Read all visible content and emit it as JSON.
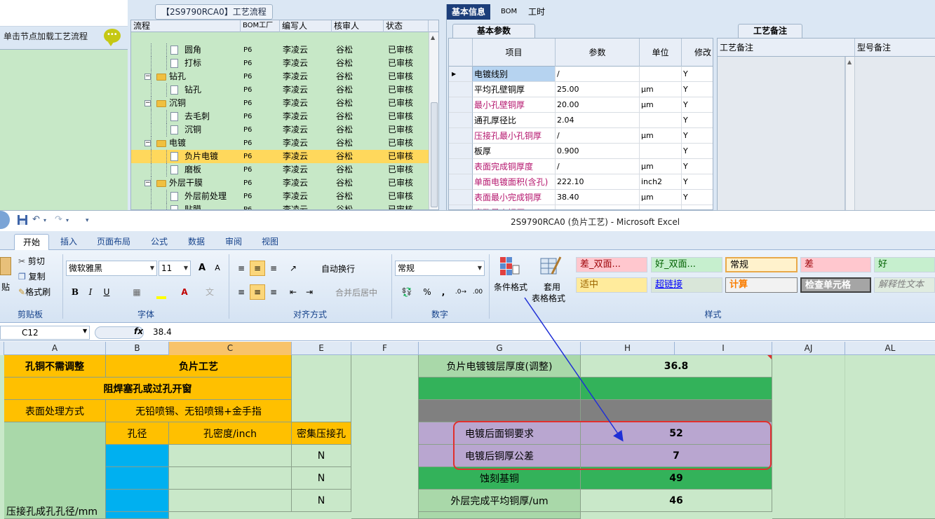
{
  "top_app": {
    "left_panel": {
      "hint": "单击节点加载工艺流程"
    },
    "flow_title": "【2S9790RCA0】工艺流程",
    "tree": {
      "columns": [
        "流程",
        "BOM工厂",
        "编写人",
        "核审人",
        "状态"
      ],
      "rows": [
        {
          "name": "圆角",
          "level": 2,
          "type": "doc",
          "factory": "P6",
          "writer": "李凌云",
          "reviewer": "谷松",
          "status": "已审核"
        },
        {
          "name": "打标",
          "level": 2,
          "type": "doc",
          "factory": "P6",
          "writer": "李凌云",
          "reviewer": "谷松",
          "status": "已审核"
        },
        {
          "name": "钻孔",
          "level": 1,
          "type": "folder",
          "factory": "P6",
          "writer": "李凌云",
          "reviewer": "谷松",
          "status": "已审核"
        },
        {
          "name": "钻孔",
          "level": 2,
          "type": "doc",
          "factory": "P6",
          "writer": "李凌云",
          "reviewer": "谷松",
          "status": "已审核"
        },
        {
          "name": "沉铜",
          "level": 1,
          "type": "folder",
          "factory": "P6",
          "writer": "李凌云",
          "reviewer": "谷松",
          "status": "已审核"
        },
        {
          "name": "去毛刺",
          "level": 2,
          "type": "doc",
          "factory": "P6",
          "writer": "李凌云",
          "reviewer": "谷松",
          "status": "已审核"
        },
        {
          "name": "沉铜",
          "level": 2,
          "type": "doc",
          "factory": "P6",
          "writer": "李凌云",
          "reviewer": "谷松",
          "status": "已审核"
        },
        {
          "name": "电镀",
          "level": 1,
          "type": "folder",
          "factory": "P6",
          "writer": "李凌云",
          "reviewer": "谷松",
          "status": "已审核"
        },
        {
          "name": "负片电镀",
          "level": 2,
          "type": "doc",
          "factory": "P6",
          "writer": "李凌云",
          "reviewer": "谷松",
          "status": "已审核",
          "selected": true
        },
        {
          "name": "磨板",
          "level": 2,
          "type": "doc",
          "factory": "P6",
          "writer": "李凌云",
          "reviewer": "谷松",
          "status": "已审核"
        },
        {
          "name": "外层干膜",
          "level": 1,
          "type": "folder",
          "factory": "P6",
          "writer": "李凌云",
          "reviewer": "谷松",
          "status": "已审核"
        },
        {
          "name": "外层前处理",
          "level": 2,
          "type": "doc",
          "factory": "P6",
          "writer": "李凌云",
          "reviewer": "谷松",
          "status": "已审核"
        },
        {
          "name": "贴膜",
          "level": 2,
          "type": "doc",
          "factory": "P6",
          "writer": "李凌云",
          "reviewer": "谷松",
          "status": "已审核"
        }
      ]
    },
    "right_tabs": [
      "基本信息",
      "BOM",
      "工时"
    ],
    "basic_params_tab": "基本参数",
    "craft_note_tab": "工艺备注",
    "params_grid": {
      "columns": [
        "项目",
        "参数",
        "单位",
        "修改"
      ],
      "rows": [
        {
          "item": "电镀线别",
          "value": "/",
          "unit": "",
          "mod": "Y",
          "magenta": false,
          "current": true
        },
        {
          "item": "平均孔壁铜厚",
          "value": "25.00",
          "unit": "μm",
          "mod": "Y",
          "magenta": false
        },
        {
          "item": "最小孔壁铜厚",
          "value": "20.00",
          "unit": "μm",
          "mod": "Y",
          "magenta": true
        },
        {
          "item": "通孔厚径比",
          "value": "2.04",
          "unit": "",
          "mod": "Y",
          "magenta": false
        },
        {
          "item": "压接孔最小孔铜厚",
          "value": "/",
          "unit": "μm",
          "mod": "Y",
          "magenta": true
        },
        {
          "item": "板厚",
          "value": "0.900",
          "unit": "",
          "mod": "Y",
          "magenta": false
        },
        {
          "item": "表面完成铜厚度",
          "value": "/",
          "unit": "μm",
          "mod": "Y",
          "magenta": true
        },
        {
          "item": "单面电镀面积(含孔)",
          "value": "222.10",
          "unit": "inch2",
          "mod": "Y",
          "magenta": true
        },
        {
          "item": "表面最小完成铜厚",
          "value": "38.40",
          "unit": "μm",
          "mod": "Y",
          "magenta": true
        },
        {
          "item": "塞孔最小铜厚",
          "value": "/",
          "unit": "μm",
          "mod": "Y",
          "magenta": true
        }
      ]
    },
    "notes": {
      "col1": "工艺备注",
      "col2": "型号备注"
    }
  },
  "excel": {
    "title": "2S9790RCA0 (负片工艺)  - Microsoft Excel",
    "tabs": [
      "开始",
      "插入",
      "页面布局",
      "公式",
      "数据",
      "审阅",
      "视图"
    ],
    "ribbon": {
      "clipboard": {
        "paste": "贴",
        "cut": "剪切",
        "copy": "复制",
        "format_painter": "格式刷",
        "label": "剪贴板"
      },
      "font": {
        "name": "微软雅黑",
        "size": "11",
        "bold": "B",
        "italic": "I",
        "underline": "U",
        "grow": "A",
        "shrink": "A",
        "label": "字体"
      },
      "align": {
        "wrap": "自动换行",
        "merge": "合并后居中",
        "label": "对齐方式"
      },
      "number": {
        "format": "常规",
        "percent": "%",
        "comma": ",",
        "label": "数字"
      },
      "styles_group": {
        "cond_format": "条件格式",
        "table_format_1": "套用",
        "table_format_2": "表格格式",
        "label": "样式"
      },
      "styles": [
        {
          "label": "差_双面...",
          "bg": "#ffc7ce",
          "fg": "#9c0006"
        },
        {
          "label": "好_双面...",
          "bg": "#c6efce",
          "fg": "#006100"
        },
        {
          "label": "常规",
          "bg": "#fff2cc",
          "fg": "#000000"
        },
        {
          "label": "差",
          "bg": "#ffc7ce",
          "fg": "#9c0006"
        },
        {
          "label": "好",
          "bg": "#c6efce",
          "fg": "#006100"
        },
        {
          "label": "适中",
          "bg": "#ffeb9c",
          "fg": "#9c6500"
        },
        {
          "label": "超链接",
          "bg": "#d9e6d9",
          "fg": "#0000ff"
        },
        {
          "label": "计算",
          "bg": "#f2f2f2",
          "fg": "#fa7d00"
        },
        {
          "label": "检查单元格",
          "bg": "#a5a5a5",
          "fg": "#ffffff"
        },
        {
          "label": "解释性文本",
          "bg": "#e0ece0",
          "fg": "#7f7f7f"
        }
      ]
    },
    "name_box": "C12",
    "fx": "fx",
    "formula": "38.4",
    "columns": [
      "A",
      "B",
      "C",
      "E",
      "F",
      "G",
      "H",
      "I",
      "AJ",
      "AL"
    ],
    "cells": {
      "a1": "孔铜不需调整",
      "bc1": "负片工艺",
      "ac2": "阻焊塞孔或过孔开窗",
      "a3": "表面处理方式",
      "bc3": "无铅喷锡、无铅喷锡+金手指",
      "b4": "孔径",
      "c4": "孔密度/inch",
      "e4": "密集压接孔",
      "a_bottom": "压接孔成孔孔径/mm",
      "e5": "N",
      "e6": "N",
      "e7": "N",
      "g1": "负片电镀镀层厚度(调整)",
      "h1": "36.8",
      "g4": "电镀后面铜要求",
      "h4": "52",
      "g5": "电镀后铜厚公差",
      "h5": "7",
      "g6": "蚀刻基铜",
      "h6": "49",
      "g7": "外层完成平均铜厚/um",
      "h7": "46"
    }
  }
}
